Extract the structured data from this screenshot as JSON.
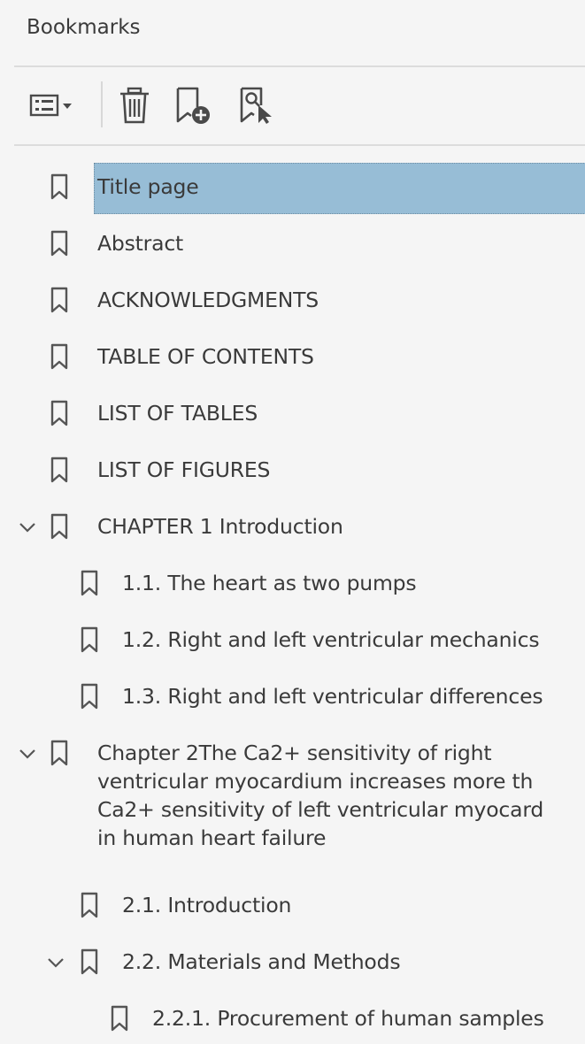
{
  "panel": {
    "title": "Bookmarks"
  },
  "toolbar": {
    "options_icon": "options-menu-icon",
    "delete_icon": "trash-icon",
    "new_bookmark_icon": "new-bookmark-icon",
    "find_bookmark_icon": "find-current-bookmark-icon"
  },
  "colors": {
    "selection": "#97bdd6",
    "text": "#3a3a3a",
    "background": "#f5f5f5"
  },
  "bookmarks": {
    "items": [
      {
        "label": "Title page",
        "selected": true
      },
      {
        "label": "Abstract"
      },
      {
        "label": "ACKNOWLEDGMENTS"
      },
      {
        "label": "TABLE OF CONTENTS"
      },
      {
        "label": "LIST OF TABLES"
      },
      {
        "label": "LIST OF FIGURES"
      },
      {
        "label": "CHAPTER 1 Introduction",
        "expanded": true
      },
      {
        "label": "1.1. The heart as two pumps"
      },
      {
        "label": "1.2. Right and left ventricular mechanics"
      },
      {
        "label": "1.3. Right and left ventricular differences"
      },
      {
        "label_lines": [
          "Chapter 2The Ca2+ sensitivity of right",
          "ventricular myocardium increases more th",
          "Ca2+ sensitivity of left ventricular myocard",
          "in human heart failure"
        ],
        "expanded": true
      },
      {
        "label": "2.1. Introduction"
      },
      {
        "label": "2.2. Materials and Methods",
        "expanded": true
      },
      {
        "label": "2.2.1. Procurement of human samples"
      }
    ]
  }
}
